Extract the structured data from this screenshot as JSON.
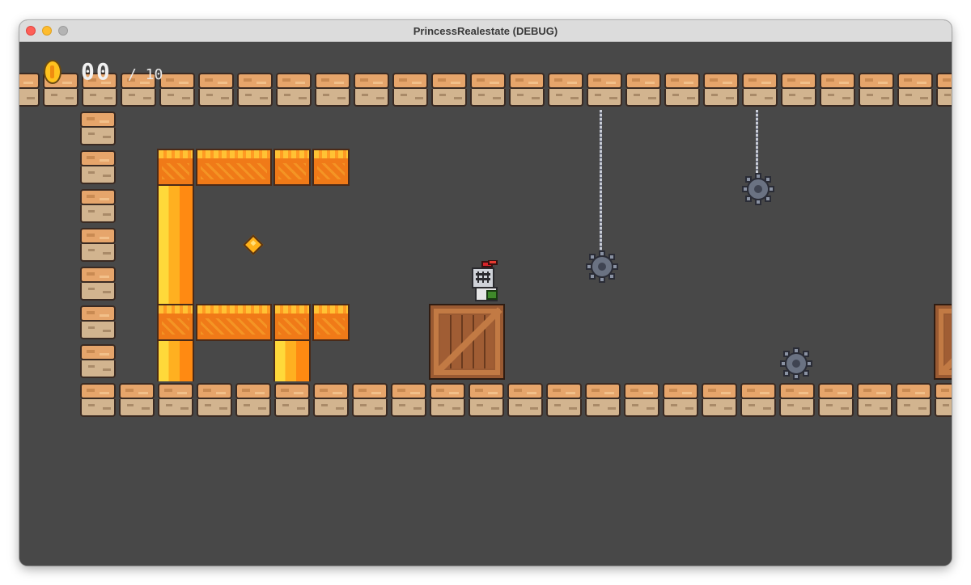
{
  "window": {
    "title": "PrincessRealestate (DEBUG)"
  },
  "hud": {
    "coins_collected": "00",
    "coins_total": "/ 10",
    "coin_icon": "coin-icon"
  },
  "colors": {
    "background": "#484848",
    "stone": "#e6a56b",
    "lava": "#f07a18",
    "crate": "#9a5a32",
    "mace": "#6a7282"
  },
  "icons": [
    "coin-icon",
    "knight-player",
    "spiked-mace",
    "lava-block",
    "wooden-crate",
    "orange-gem"
  ]
}
